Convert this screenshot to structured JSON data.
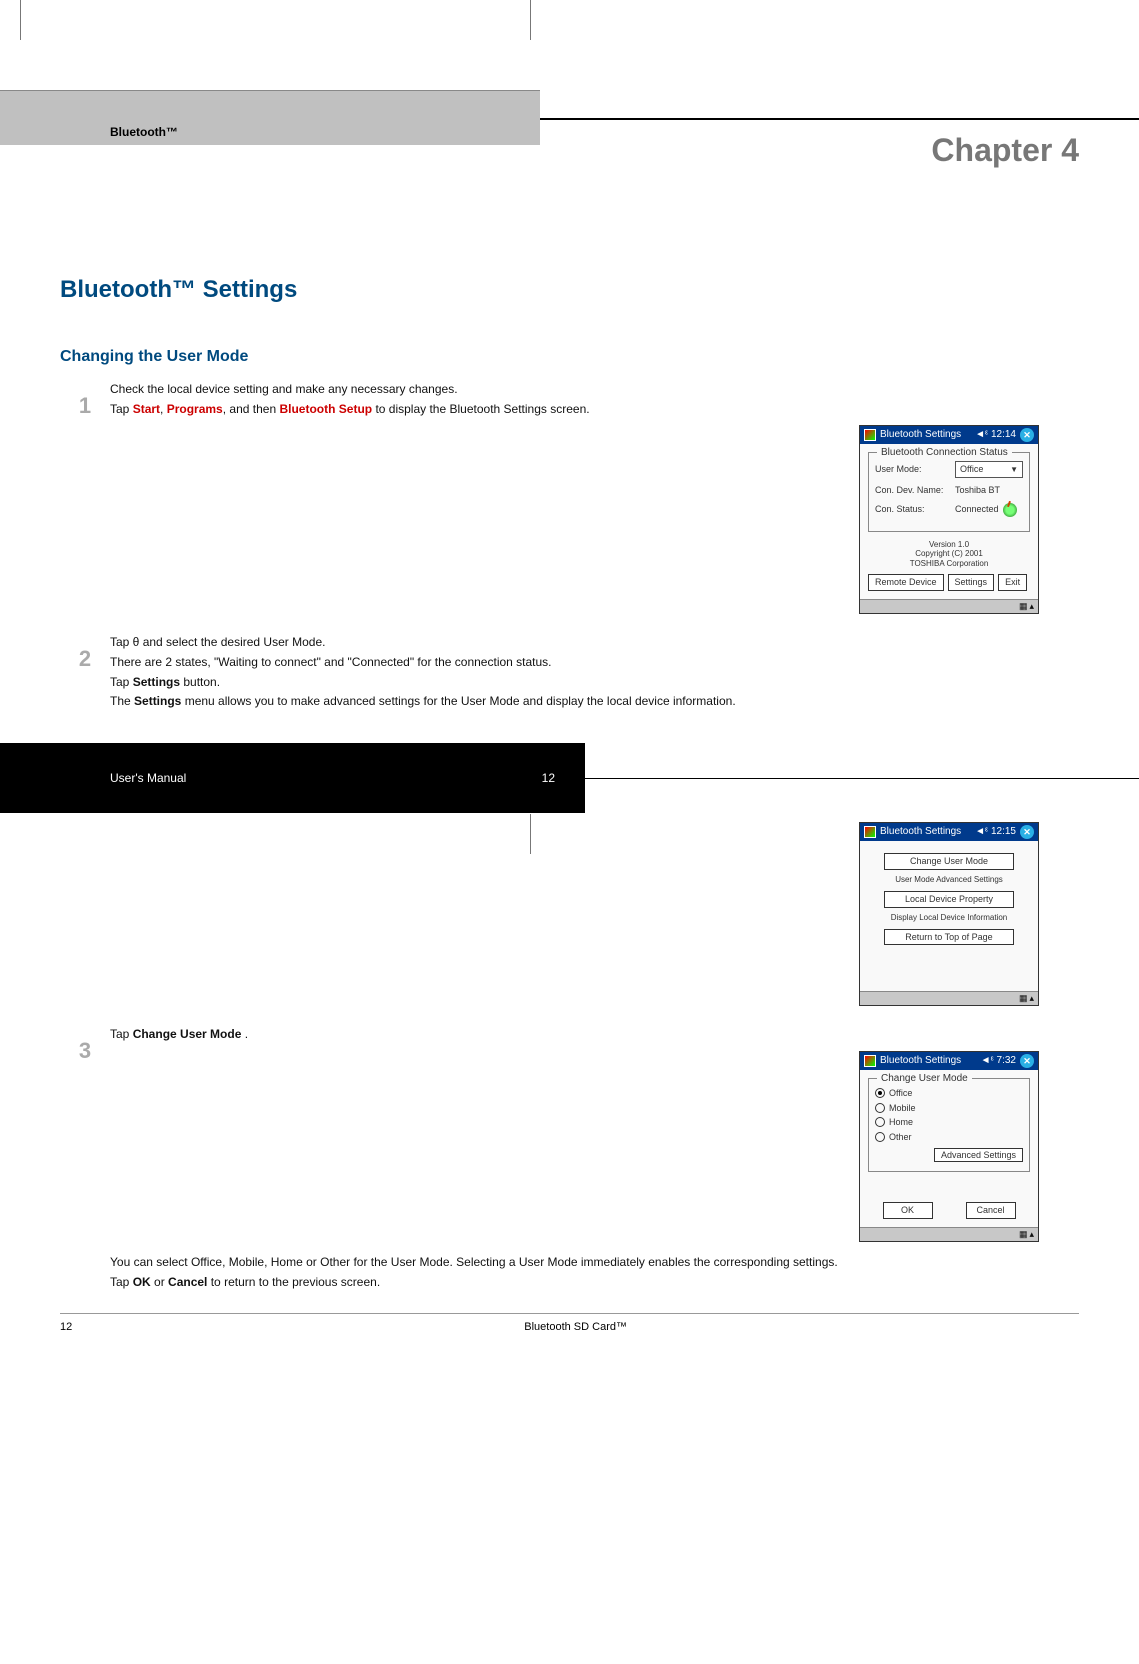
{
  "header": {
    "brand": "Bluetooth™",
    "chapter": "Chapter 4"
  },
  "section": {
    "h1": "Bluetooth™ Settings",
    "h2": "Changing the User Mode"
  },
  "steps": {
    "s1": {
      "num": "1",
      "line1": "Check the local device setting and make any necessary changes.",
      "line2_pre": "Tap ",
      "line2_a": "Start",
      "line2_sep1": ", ",
      "line2_b": "Programs",
      "line2_sep2": ", and then ",
      "line2_c": "Bluetooth Setup",
      "line2_post": " to display the Bluetooth Settings screen."
    },
    "s2": {
      "num": "2",
      "line1": "Tap θ and select the desired User Mode.",
      "line2": "There are 2 states, \"Waiting to connect\" and \"Connected\" for the connection status.",
      "line3_pre": "Tap ",
      "line3_b": "Settings",
      "line3_post": " button.",
      "line4_pre": "The ",
      "line4_b": "Settings",
      "line4_post": " menu allows you to make advanced settings for the User Mode and display the local device information."
    },
    "s3": {
      "num": "3",
      "line1_pre": "Tap ",
      "line1_b": "Change User Mode",
      "line1_post": " ."
    },
    "final": {
      "line1": "You can select Office, Mobile, Home or Other for the User Mode. Selecting a User Mode immediately enables the corresponding settings.",
      "line2_pre": "Tap ",
      "line2_a": "OK",
      "line2_mid": " or ",
      "line2_b": "Cancel",
      "line2_post": " to return to the previous screen."
    }
  },
  "scr1": {
    "title": "Bluetooth Settings",
    "clock": "◄ᵋ 12:14",
    "legend": "Bluetooth Connection Status",
    "usermode_label": "User Mode:",
    "usermode_value": "Office",
    "devname_label": "Con. Dev. Name:",
    "devname_value": "Toshiba BT",
    "constatus_label": "Con. Status:",
    "constatus_value": "Connected",
    "version_l1": "Version 1.0",
    "version_l2": "Copyright (C) 2001",
    "version_l3": "TOSHIBA Corporation",
    "btn1": "Remote Device",
    "btn2": "Settings",
    "btn3": "Exit"
  },
  "scr2": {
    "title": "Bluetooth Settings",
    "clock": "◄ᵋ 12:15",
    "btn1": "Change User Mode",
    "desc1": "User Mode Advanced Settings",
    "btn2": "Local Device Property",
    "desc2": "Display Local Device Information",
    "btn3": "Return to Top of Page"
  },
  "scr3": {
    "title": "Bluetooth Settings",
    "clock": "◄ᵋ 7:32",
    "legend": "Change User Mode",
    "opt1": "Office",
    "opt2": "Mobile",
    "opt3": "Home",
    "opt4": "Other",
    "adv_btn": "Advanced Settings",
    "ok": "OK",
    "cancel": "Cancel"
  },
  "blackbar": {
    "title": "User's Manual",
    "page": "12"
  },
  "footer": {
    "page": "12",
    "product": "Bluetooth SD Card™"
  }
}
